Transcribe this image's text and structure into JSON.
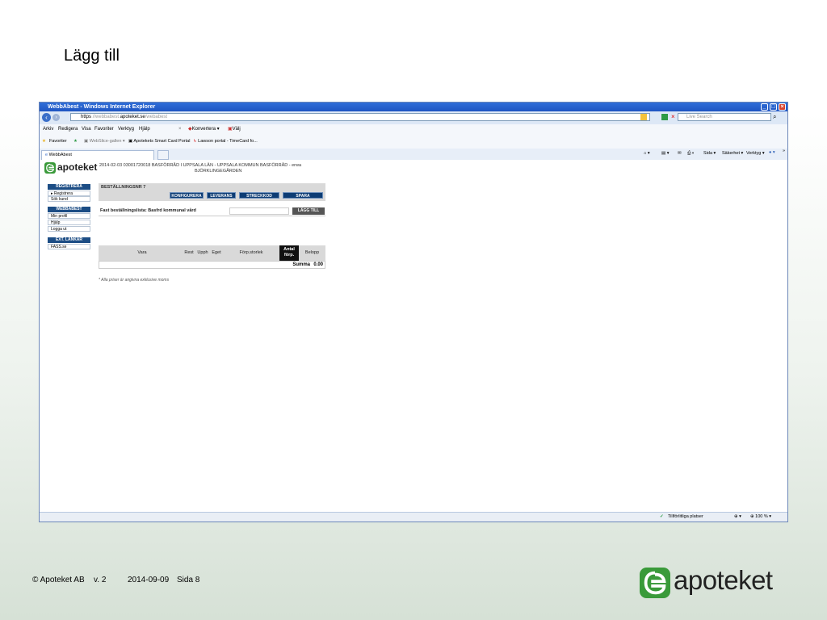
{
  "slide": {
    "title": "Lägg till",
    "footer": {
      "copyright": "© Apoteket AB",
      "version": "v. 2",
      "date": "2014-09-09",
      "page": "Sida 8"
    },
    "logo_text": "apoteket",
    "brand_color": "#3a9a3a"
  },
  "browser": {
    "window_title": "WebbAbest - Windows Internet Explorer",
    "url_prefix": "https",
    "url_host_pre": "//webbabest.",
    "url_host": "apoteket.se",
    "url_path": "/webabest",
    "search_placeholder": "Live Search",
    "menu": [
      "Arkiv",
      "Redigera",
      "Visa",
      "Favoriter",
      "Verktyg",
      "Hjälp"
    ],
    "konvertera": "Konvertera",
    "valj": "Välj",
    "favorites_label": "Favoriter",
    "favorites": [
      "WebSlice-gallen",
      "Apotekets Smart Card Portal",
      "Lawson portal - TimeCard fo..."
    ],
    "tab_label": "WebbAbest",
    "toolbar_right": [
      "Sida",
      "Säkerhet",
      "Verktyg"
    ],
    "status_zone": "Tillförlitliga platser",
    "zoom": "100 %"
  },
  "app": {
    "logo_text": "apoteket",
    "header_line1": "2014-02-03   03001720018  BASFÖRRÅD I UPPSALA LÄN - UPPSALA KOMMUN BASFÖRRÅD -   erwa",
    "header_line2": "BJÖRKLINGEGÅRDEN",
    "nav": {
      "registrera_head": "REGISTRERA",
      "registrera_items": [
        "Registrera",
        "Sök kund"
      ],
      "webbabest_head": "WEBBABEST",
      "webbabest_items": [
        "Min profil",
        "Hjälp",
        "Logga ut"
      ],
      "ext_head": "EXT. LÄNKAR",
      "ext_items": [
        "FASS.se"
      ]
    },
    "order": {
      "title": "BESTÄLLNINGSNR 7",
      "buttons": [
        "KONFIGURERA",
        "LEVERANS",
        "STRECKKOD",
        "SPARA"
      ]
    },
    "list": {
      "label": "Fast beställningslista: Basfrd kommunal vård",
      "add_button": "LÄGG TILL"
    },
    "table": {
      "headers": [
        "Vara",
        "Rest",
        "Upph",
        "Eget",
        "Förp.storlek",
        "Antal förp.",
        "Belopp"
      ],
      "sum_label": "Summa",
      "sum_value": "0.00"
    },
    "note": "* Alla priser är angivna exklusive moms"
  }
}
